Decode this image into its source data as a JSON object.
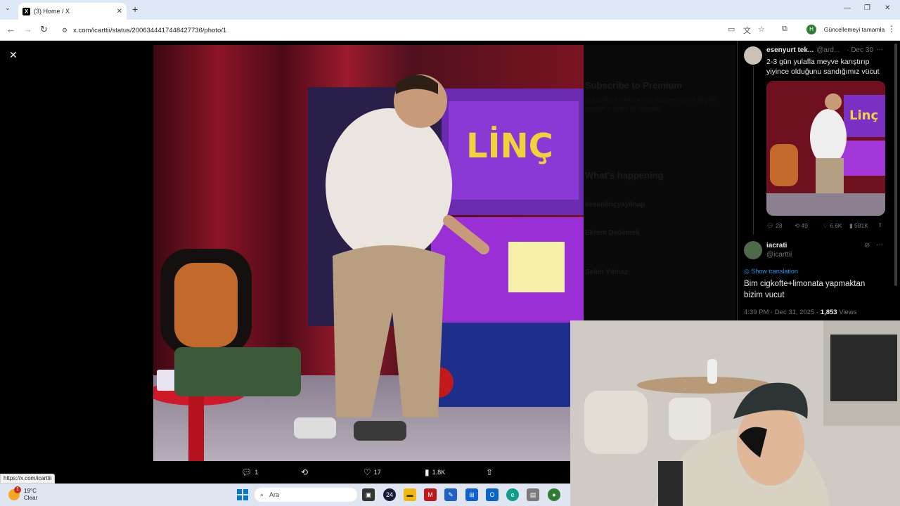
{
  "browser": {
    "tab_title": "(3) Home / X",
    "tab_favicon": "X",
    "new_tab": "+",
    "url": "x.com/icarttii/status/2006344417448427736/photo/1",
    "profile_initial": "H",
    "update_label": "Güncellemeyi tamamla"
  },
  "viewer": {
    "actions": {
      "replies": "1",
      "likes": "17",
      "views": "1.8K"
    }
  },
  "background_sidebar": {
    "premium_title": "Subscribe to Premium",
    "premium_desc": "Subscribe to unlock new features and if eligible, receive a share of revenue.",
    "happening_title": "What's happening",
    "trend1": "#esenlinçyayilnap",
    "trend2": "Ekrem Dedemek",
    "trend3": "Selim Yılmaz"
  },
  "thread": {
    "parent": {
      "name": "esenyurt tek...",
      "handle": "@ard...",
      "date": "· Dec 30",
      "text": "2-3 gün yulafla meyve karıştırıp yiyince olduğunu sandığımız vücut",
      "replies": "28",
      "retweets": "49",
      "likes": "6.6K",
      "views": "581K"
    },
    "main": {
      "name": "iacrati",
      "handle": "@icarttii",
      "translate": "Show translation",
      "text": "Bim cigkofte+limonata yapmaktan bizim vucut",
      "time": "4:39 PM · Dec 31, 2025 · ",
      "views_count": "1,853",
      "views_label": " Views"
    }
  },
  "status_url": "https://x.com/icarttii",
  "taskbar": {
    "temp": "19°C",
    "condition": "Clear",
    "badge": "1",
    "search_placeholder": "Ara"
  },
  "colors": {
    "accent": "#1d9bf0",
    "tab_strip": "#dfe8f7",
    "taskbar": "#dfe6f1"
  }
}
